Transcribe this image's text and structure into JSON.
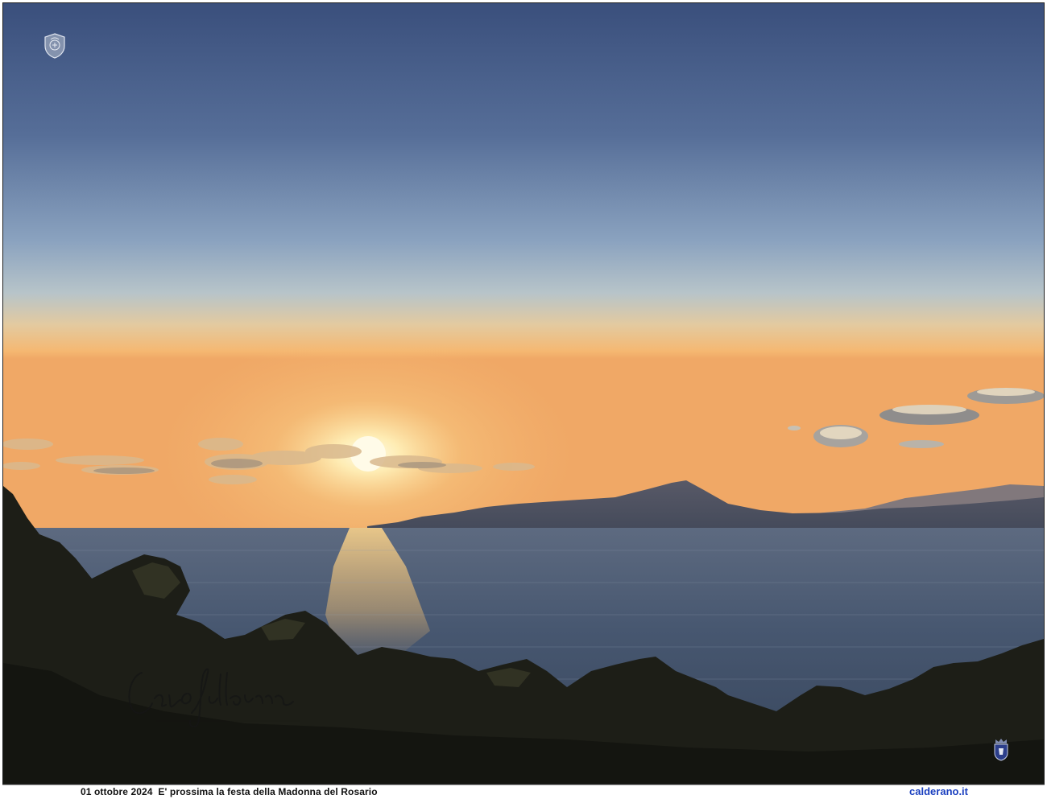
{
  "caption": {
    "date": "01 ottobre 2024",
    "text": "E' prossima la festa della Madonna del Rosario",
    "site": "calderano.it"
  },
  "photo": {
    "subject": "sunset-over-sea-with-mountains",
    "colors": {
      "sky_top": "#3f5580",
      "sky_mid": "#8fa8c4",
      "horizon_glow": "#f3b766",
      "sun": "#fff6d6",
      "sea": "#3b4a62",
      "mountains": "#4a4f5e",
      "foliage": "#1c1d16"
    }
  },
  "overlays": {
    "logo_icon": "logo-emblem-icon",
    "signature_icon": "handwritten-signature-icon",
    "crest_icon": "coat-of-arms-icon"
  }
}
